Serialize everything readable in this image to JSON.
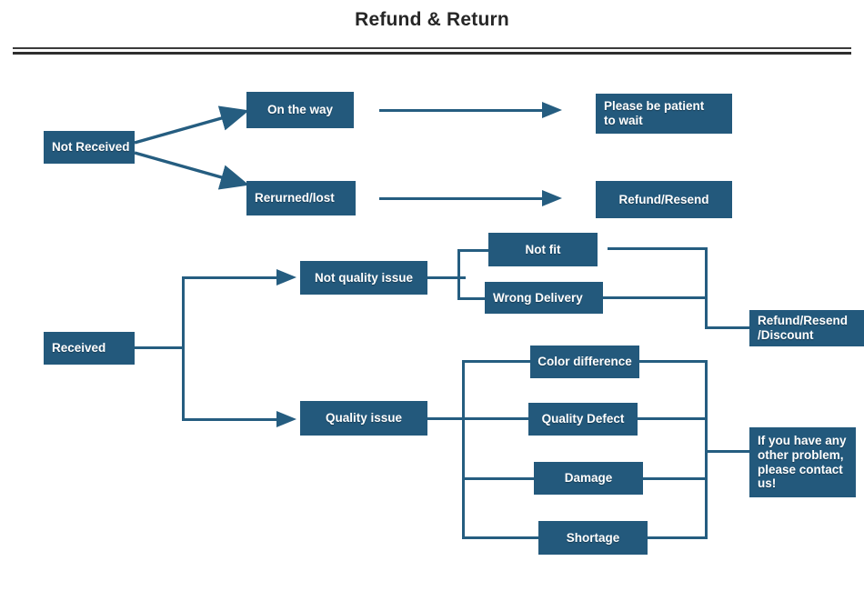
{
  "header": {
    "title": "Refund & Return"
  },
  "diagram": {
    "type": "flowchart",
    "accent_color": "#23597c",
    "connector_color": "#255d80",
    "text_color": "#ffffff",
    "background_color": "#ffffff",
    "branches": [
      {
        "root": "Not Received",
        "steps": [
          {
            "cause": "On the way",
            "outcome": "Please be patient to wait"
          },
          {
            "cause": "Rerurned/lost",
            "outcome": "Refund/Resend"
          }
        ]
      },
      {
        "root": "Received",
        "categories": [
          {
            "name": "Not quality issue",
            "reasons": [
              "Not fit",
              "Wrong Delivery"
            ],
            "outcome": "Refund/Resend/Discount"
          },
          {
            "name": "Quality issue",
            "reasons": [
              "Color difference",
              "Quality Defect",
              "Damage",
              "Shortage"
            ],
            "outcome": "If you have any other problem, please contact us!"
          }
        ]
      }
    ],
    "nodes": {
      "not_received": "Not Received",
      "on_the_way": "On the way",
      "returned_lost": "Rerurned/lost",
      "please_wait": "Please be patient to wait",
      "refund_resend": "Refund/Resend",
      "received": "Received",
      "not_quality_issue": "Not quality issue",
      "quality_issue": "Quality issue",
      "not_fit": "Not fit",
      "wrong_delivery": "Wrong Delivery",
      "color_difference": "Color difference",
      "quality_defect": "Quality Defect",
      "damage": "Damage",
      "shortage": "Shortage",
      "refund_resend_discount_line1": "Refund/Resend",
      "refund_resend_discount_line2": "/Discount",
      "contact_us_line1": "If you have any",
      "contact_us_line2": " other problem,",
      "contact_us_line3": "please contact",
      "contact_us_line4": "us!",
      "please_wait_line1": "Please be patient",
      "please_wait_line2": "to wait"
    }
  }
}
